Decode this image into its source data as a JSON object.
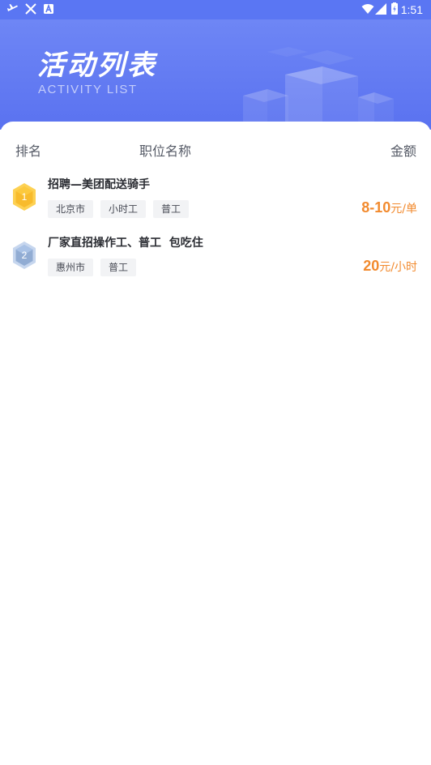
{
  "status_bar": {
    "time": "1:51",
    "left_icons": [
      "plane-icon",
      "x-icon",
      "notification-a-icon"
    ],
    "right_icons": [
      "wifi-icon",
      "signal-icon",
      "battery-icon"
    ]
  },
  "header": {
    "title": "活动列表",
    "subtitle": "ACTIVITY LIST"
  },
  "table": {
    "columns": {
      "rank": "排名",
      "title": "职位名称",
      "amount": "金额"
    },
    "rows": [
      {
        "rank": "1",
        "badge": "gold",
        "title": "招聘—美团配送骑手",
        "tags": [
          "北京市",
          "小时工",
          "普工"
        ],
        "price": "8-10",
        "unit": "元/单"
      },
      {
        "rank": "2",
        "badge": "silver",
        "title": "厂家直招操作工、普工  包吃住",
        "tags": [
          "惠州市",
          "普工"
        ],
        "price": "20",
        "unit": "元/小时"
      }
    ]
  },
  "colors": {
    "header_blue": "#5a72f0",
    "price_orange": "#f28a2e",
    "badge_gold": "#fcc93d",
    "badge_silver": "#a9c2e6"
  }
}
